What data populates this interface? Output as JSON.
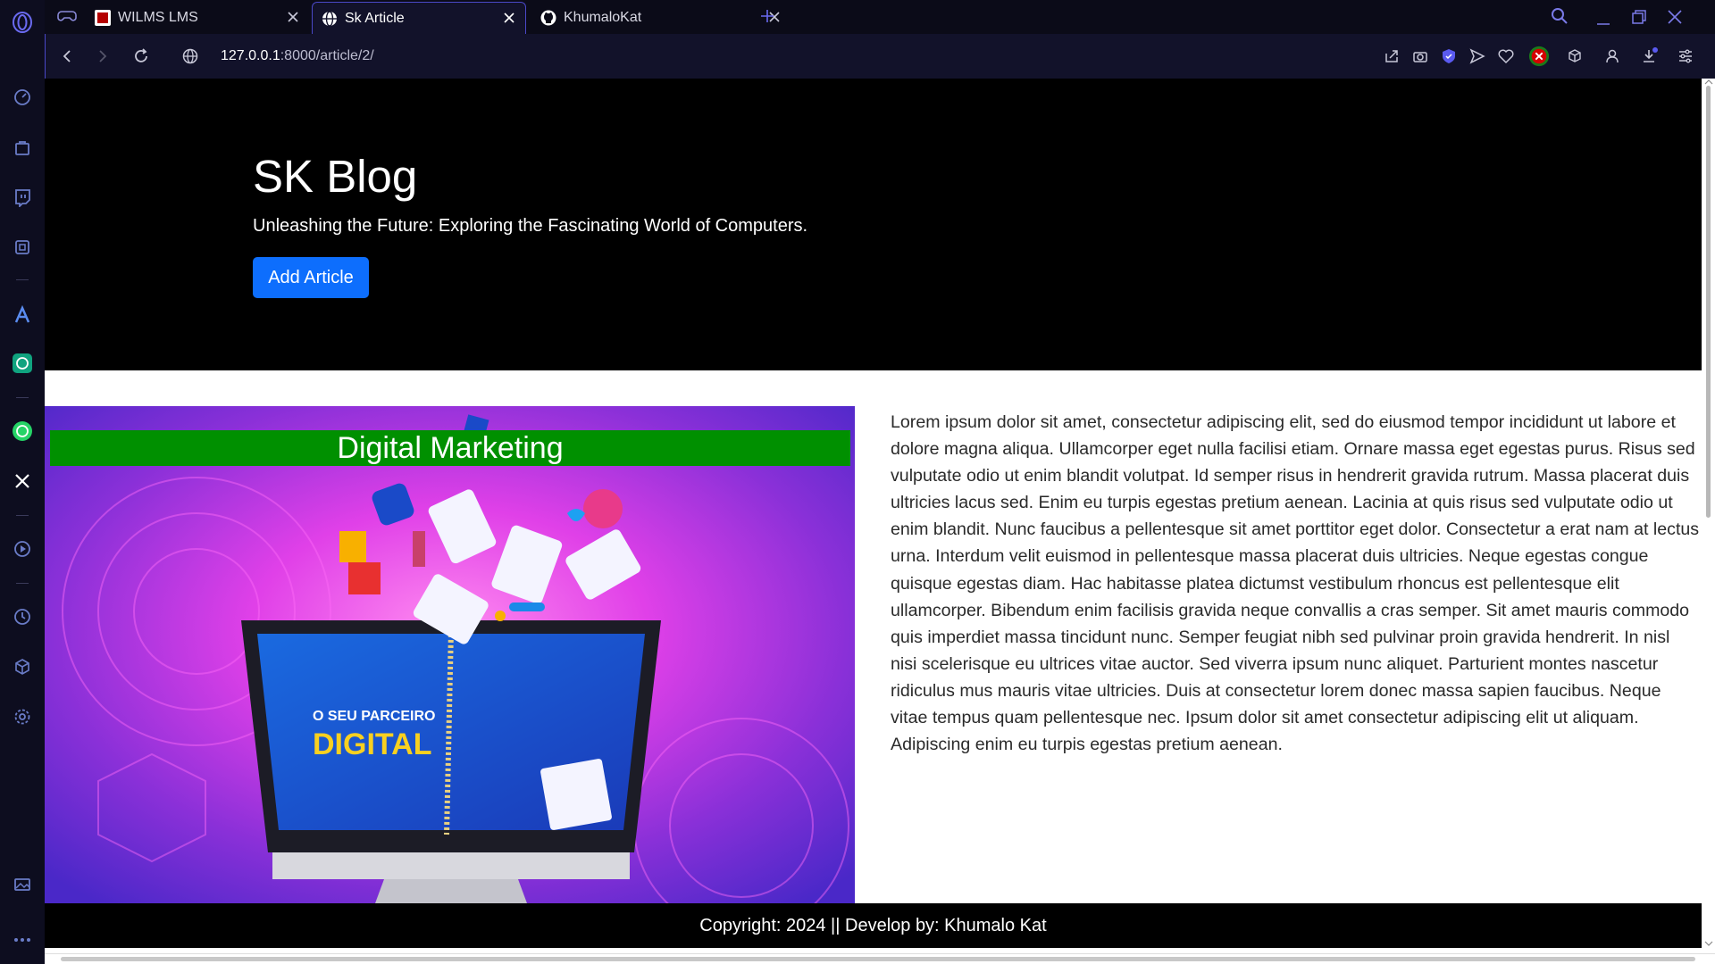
{
  "browser": {
    "tabs": [
      {
        "title": "WILMS LMS",
        "favicon": "wilms-logo-icon",
        "active": false
      },
      {
        "title": "Sk Article",
        "favicon": "globe-icon",
        "active": true
      },
      {
        "title": "KhumaloKat",
        "favicon": "github-icon",
        "active": false
      }
    ],
    "url": {
      "host": "127.0.0.1",
      "path": ":8000/article/2/"
    },
    "accent_color": "#4a48c8"
  },
  "page": {
    "hero": {
      "title": "SK Blog",
      "subtitle": "Unleashing the Future: Exploring the Fascinating World of Computers.",
      "add_button": "Add Article"
    },
    "article": {
      "image_banner": "Digital Marketing",
      "image_subtext": "O SEU PARCEIRO DIGITAL",
      "body": "Lorem ipsum dolor sit amet, consectetur adipiscing elit, sed do eiusmod tempor incididunt ut labore et dolore magna aliqua. Ullamcorper eget nulla facilisi etiam. Ornare massa eget egestas purus. Risus sed vulputate odio ut enim blandit volutpat. Id semper risus in hendrerit gravida rutrum. Massa placerat duis ultricies lacus sed. Enim eu turpis egestas pretium aenean. Lacinia at quis risus sed vulputate odio ut enim blandit. Nunc faucibus a pellentesque sit amet porttitor eget dolor. Consectetur a erat nam at lectus urna. Interdum velit euismod in pellentesque massa placerat duis ultricies. Neque egestas congue quisque egestas diam. Hac habitasse platea dictumst vestibulum rhoncus est pellentesque elit ullamcorper. Bibendum enim facilisis gravida neque convallis a cras semper. Sit amet mauris commodo quis imperdiet massa tincidunt nunc. Semper feugiat nibh sed pulvinar proin gravida hendrerit. In nisl nisi scelerisque eu ultrices vitae auctor. Sed viverra ipsum nunc aliquet. Parturient montes nascetur ridiculus mus mauris vitae ultricies. Duis at consectetur lorem donec massa sapien faucibus. Neque vitae tempus quam pellentesque nec. Ipsum dolor sit amet consectetur adipiscing elit ut aliquam. Adipiscing enim eu turpis egestas pretium aenean."
    },
    "footer": "Copyright: 2024 || Develop by: Khumalo Kat",
    "colors": {
      "button": "#0d6efd",
      "banner": "#009000",
      "hero_bg": "#000000"
    }
  }
}
